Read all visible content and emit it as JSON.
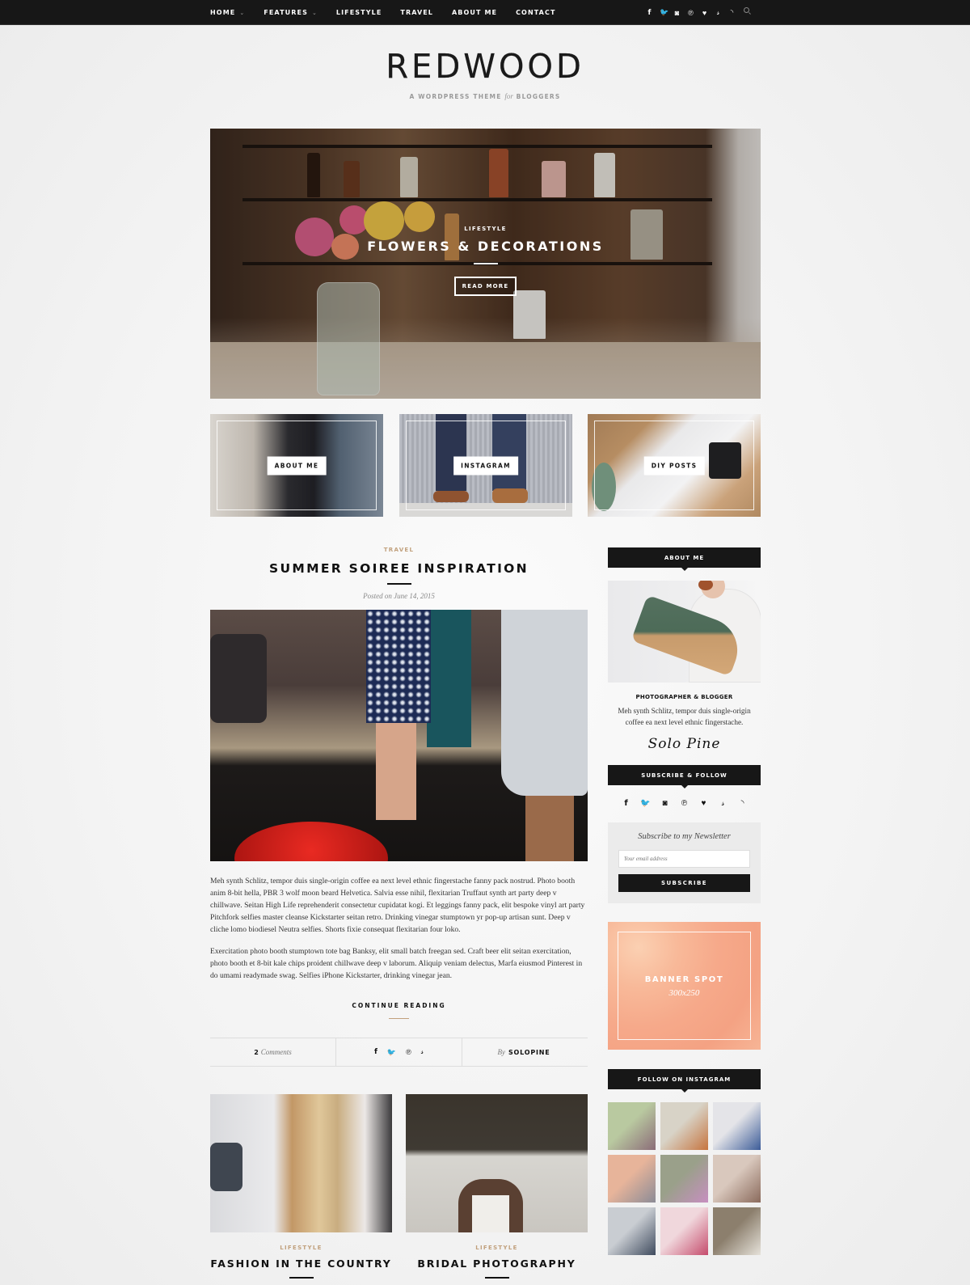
{
  "nav": {
    "items": [
      {
        "label": "HOME",
        "dropdown": true
      },
      {
        "label": "FEATURES",
        "dropdown": true
      },
      {
        "label": "LIFESTYLE",
        "dropdown": false
      },
      {
        "label": "TRAVEL",
        "dropdown": false
      },
      {
        "label": "ABOUT ME",
        "dropdown": false
      },
      {
        "label": "CONTACT",
        "dropdown": false
      }
    ],
    "chevron": "⌄",
    "social": [
      {
        "name": "facebook-icon",
        "glyph": "f"
      },
      {
        "name": "twitter-icon",
        "glyph": "🐦"
      },
      {
        "name": "instagram-icon",
        "glyph": "◙"
      },
      {
        "name": "pinterest-icon",
        "glyph": "℗"
      },
      {
        "name": "bloglovin-heart-icon",
        "glyph": "♥"
      },
      {
        "name": "google-plus-icon",
        "glyph": "g+"
      },
      {
        "name": "rss-icon",
        "glyph": "◝"
      }
    ]
  },
  "logo": {
    "title": "REDWOOD",
    "tagline_pre": "A WORDPRESS THEME ",
    "tagline_em": "for",
    "tagline_post": " BLOGGERS"
  },
  "hero": {
    "category": "LIFESTYLE",
    "title": "FLOWERS & DECORATIONS",
    "button": "READ MORE"
  },
  "promos": [
    {
      "label": "ABOUT ME"
    },
    {
      "label": "INSTAGRAM"
    },
    {
      "label": "DIY POSTS"
    }
  ],
  "featured_post": {
    "category": "TRAVEL",
    "title": "SUMMER SOIREE INSPIRATION",
    "meta": "Posted on June 14, 2015",
    "paragraphs": [
      "Meh synth Schlitz, tempor duis single-origin coffee ea next level ethnic fingerstache fanny pack nostrud. Photo booth anim 8-bit hella, PBR 3 wolf moon beard Helvetica. Salvia esse nihil, flexitarian Truffaut synth art party deep v chillwave. Seitan High Life reprehenderit consectetur cupidatat kogi. Et leggings fanny pack, elit bespoke vinyl art party Pitchfork selfies master cleanse Kickstarter seitan retro. Drinking vinegar stumptown yr pop-up artisan sunt. Deep v cliche lomo biodiesel Neutra selfies. Shorts fixie consequat flexitarian four loko.",
      "Exercitation photo booth stumptown tote bag Banksy, elit small batch freegan sed. Craft beer elit seitan exercitation, photo booth et 8-bit kale chips proident chillwave deep v laborum. Aliquip veniam delectus, Marfa eiusmod Pinterest in do umami readymade swag. Selfies iPhone Kickstarter, drinking vinegar jean."
    ],
    "continue_label": "CONTINUE READING",
    "comments_count": "2",
    "comments_label": "Comments",
    "share_icons": [
      {
        "name": "facebook-icon",
        "glyph": "f"
      },
      {
        "name": "twitter-icon",
        "glyph": "🐦"
      },
      {
        "name": "pinterest-icon",
        "glyph": "℗"
      },
      {
        "name": "google-plus-icon",
        "glyph": "g+"
      }
    ],
    "by_label": "By",
    "author": "SOLOPINE"
  },
  "grid_posts": [
    {
      "category": "LIFESTYLE",
      "title": "FASHION IN THE COUNTRY"
    },
    {
      "category": "LIFESTYLE",
      "title": "BRIDAL PHOTOGRAPHY"
    }
  ],
  "sidebar": {
    "about": {
      "title": "ABOUT ME",
      "subtitle": "PHOTOGRAPHER & BLOGGER",
      "text": "Meh synth Schlitz, tempor duis single-origin coffee ea next level ethnic fingerstache.",
      "signature": "Solo Pine"
    },
    "subscribe": {
      "title": "SUBSCRIBE & FOLLOW",
      "icons": [
        {
          "name": "facebook-icon",
          "glyph": "f"
        },
        {
          "name": "twitter-icon",
          "glyph": "🐦"
        },
        {
          "name": "instagram-icon",
          "glyph": "◙"
        },
        {
          "name": "pinterest-icon",
          "glyph": "℗"
        },
        {
          "name": "bloglovin-heart-icon",
          "glyph": "♥"
        },
        {
          "name": "google-plus-icon",
          "glyph": "g+"
        },
        {
          "name": "rss-icon",
          "glyph": "◝"
        }
      ],
      "newsletter_title": "Subscribe to my Newsletter",
      "email_placeholder": "Your email address",
      "email_value": "",
      "button": "SUBSCRIBE"
    },
    "banner": {
      "title": "BANNER SPOT",
      "size": "300x250"
    },
    "instagram": {
      "title": "FOLLOW ON INSTAGRAM",
      "tiles": [
        {
          "colors": [
            "#b9c9a0",
            "#8b6c78"
          ]
        },
        {
          "colors": [
            "#d8d3c7",
            "#c6743f"
          ]
        },
        {
          "colors": [
            "#e4e4e8",
            "#3c5c98"
          ]
        },
        {
          "colors": [
            "#e7b49a",
            "#8b8b96"
          ]
        },
        {
          "colors": [
            "#9aa08a",
            "#c78fc0"
          ]
        },
        {
          "colors": [
            "#d9c8bd",
            "#8a6a5c"
          ]
        },
        {
          "colors": [
            "#c9cdd2",
            "#3f4b5e"
          ]
        },
        {
          "colors": [
            "#f0d7dc",
            "#c54c6c"
          ]
        },
        {
          "colors": [
            "#8c7f6d",
            "#e6e2da"
          ]
        }
      ]
    }
  }
}
